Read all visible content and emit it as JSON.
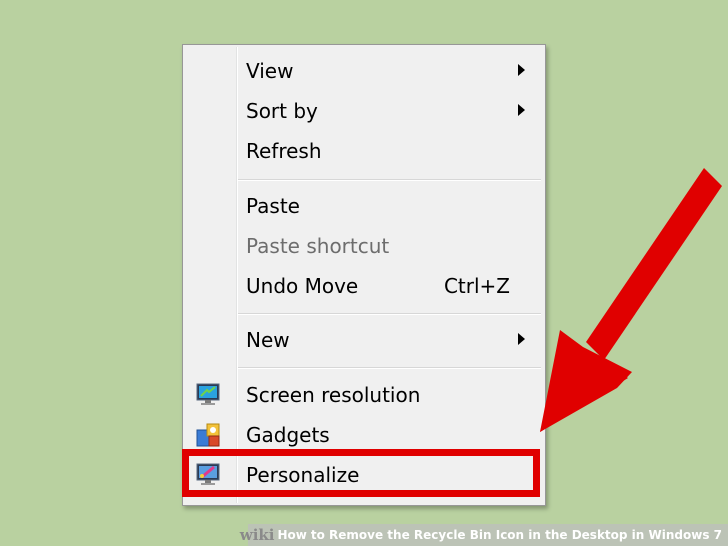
{
  "menu": {
    "items": [
      {
        "label": "View",
        "submenu": true
      },
      {
        "label": "Sort by",
        "submenu": true
      },
      {
        "label": "Refresh"
      },
      {
        "label": "Paste"
      },
      {
        "label": "Paste shortcut",
        "disabled": true
      },
      {
        "label": "Undo Move",
        "shortcut": "Ctrl+Z"
      },
      {
        "label": "New",
        "submenu": true
      },
      {
        "label": "Screen resolution",
        "icon": "monitor-icon"
      },
      {
        "label": "Gadgets",
        "icon": "gadgets-icon"
      },
      {
        "label": "Personalize",
        "icon": "personalize-icon"
      }
    ]
  },
  "annotation": {
    "arrow_color": "#e00000",
    "highlight_color": "#e00000"
  },
  "footer": {
    "brand": "wiki",
    "how": "How",
    "rest": "to Remove the Recycle Bin Icon in the Desktop in Windows 7"
  }
}
